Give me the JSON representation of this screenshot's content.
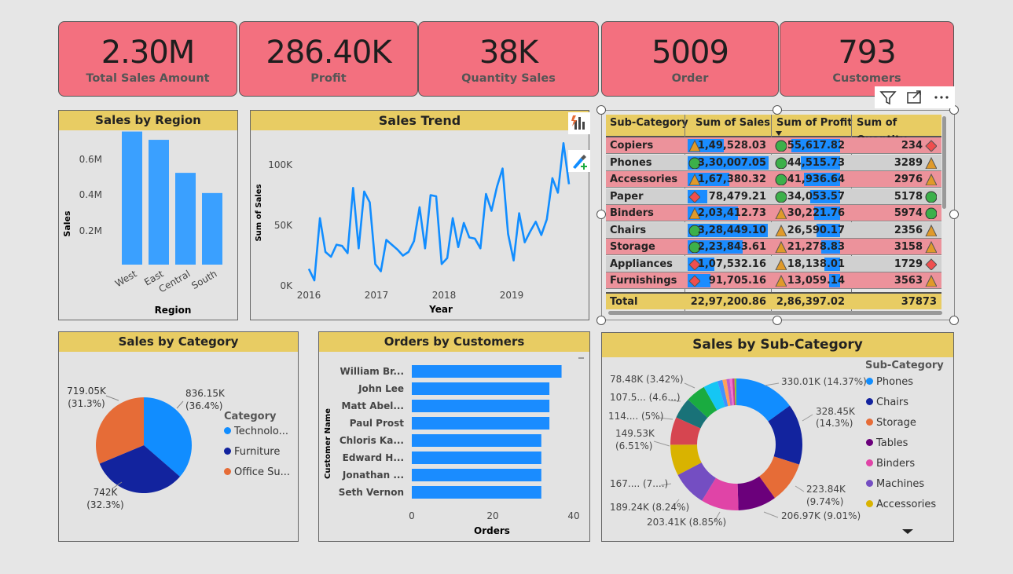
{
  "kpis": [
    {
      "value": "2.30M",
      "label": "Total Sales Amount"
    },
    {
      "value": "286.40K",
      "label": "Profit"
    },
    {
      "value": "38K",
      "label": "Quantity Sales"
    },
    {
      "value": "5009",
      "label": "Order"
    },
    {
      "value": "793",
      "label": "Customers"
    }
  ],
  "region_chart": {
    "title": "Sales by Region",
    "ylabel": "Sales",
    "xlabel": "Region",
    "ticks": [
      "0.2M",
      "0.4M",
      "0.6M"
    ],
    "chart_data": {
      "type": "bar",
      "categories": [
        "West",
        "East",
        "Central",
        "South"
      ],
      "values": [
        725000,
        680000,
        500000,
        390000
      ],
      "xlabel": "Region",
      "ylabel": "Sales",
      "ylim": [
        0,
        800000
      ]
    }
  },
  "trend_chart": {
    "title": "Sales Trend",
    "ylabel": "Sum of Sales",
    "xlabel": "Year",
    "yticks": [
      "0K",
      "50K",
      "100K"
    ],
    "xticks": [
      "2016",
      "2017",
      "2018",
      "2019"
    ],
    "chart_data": {
      "type": "line",
      "x": [
        "2016-01",
        "2016-02",
        "2016-03",
        "2016-04",
        "2016-05",
        "2016-06",
        "2016-07",
        "2016-08",
        "2016-09",
        "2016-10",
        "2016-11",
        "2016-12",
        "2017-01",
        "2017-02",
        "2017-03",
        "2017-04",
        "2017-05",
        "2017-06",
        "2017-07",
        "2017-08",
        "2017-09",
        "2017-10",
        "2017-11",
        "2017-12",
        "2018-01",
        "2018-02",
        "2018-03",
        "2018-04",
        "2018-05",
        "2018-06",
        "2018-07",
        "2018-08",
        "2018-09",
        "2018-10",
        "2018-11",
        "2018-12",
        "2019-01",
        "2019-02",
        "2019-03",
        "2019-04",
        "2019-05",
        "2019-06",
        "2019-07",
        "2019-08",
        "2019-09",
        "2019-10",
        "2019-11",
        "2019-12"
      ],
      "values": [
        14000,
        4500,
        56000,
        28000,
        24000,
        34000,
        33000,
        27000,
        81000,
        31000,
        78000,
        69000,
        18000,
        12000,
        38000,
        34000,
        30000,
        25000,
        28000,
        37000,
        65000,
        31000,
        75000,
        74000,
        18000,
        23000,
        56000,
        32000,
        52000,
        40000,
        39000,
        31000,
        76000,
        62000,
        82000,
        97000,
        43000,
        21000,
        60000,
        36000,
        45000,
        53000,
        42000,
        55000,
        89000,
        77000,
        118000,
        84000
      ],
      "xlabel": "Year",
      "ylabel": "Sum of Sales",
      "ylim": [
        0,
        120000
      ]
    }
  },
  "table": {
    "headers": [
      "Sub-Category",
      "Sum of Sales",
      "Sum of Profit",
      "Sum of Quantity"
    ],
    "rows": [
      {
        "name": "Copiers",
        "sales": "1,49,528.03",
        "profit": "55,617.82",
        "qty": "234",
        "sales_frac": 0.45,
        "profit_frac": 1.0,
        "si": "triangle",
        "pi": "circle",
        "qi": "diamond"
      },
      {
        "name": "Phones",
        "sales": "3,30,007.05",
        "profit": "44,515.73",
        "qty": "3289",
        "sales_frac": 1.0,
        "profit_frac": 0.8,
        "si": "circle",
        "pi": "circle",
        "qi": "triangle"
      },
      {
        "name": "Accessories",
        "sales": "1,67,380.32",
        "profit": "41,936.64",
        "qty": "2976",
        "sales_frac": 0.51,
        "profit_frac": 0.75,
        "si": "triangle",
        "pi": "circle",
        "qi": "triangle"
      },
      {
        "name": "Paper",
        "sales": "78,479.21",
        "profit": "34,053.57",
        "qty": "5178",
        "sales_frac": 0.24,
        "profit_frac": 0.61,
        "si": "diamond",
        "pi": "circle",
        "qi": "circle"
      },
      {
        "name": "Binders",
        "sales": "2,03,412.73",
        "profit": "30,221.76",
        "qty": "5974",
        "sales_frac": 0.62,
        "profit_frac": 0.54,
        "si": "triangle",
        "pi": "triangle",
        "qi": "circle"
      },
      {
        "name": "Chairs",
        "sales": "3,28,449.10",
        "profit": "26,590.17",
        "qty": "2356",
        "sales_frac": 0.99,
        "profit_frac": 0.48,
        "si": "circle",
        "pi": "triangle",
        "qi": "triangle"
      },
      {
        "name": "Storage",
        "sales": "2,23,843.61",
        "profit": "21,278.83",
        "qty": "3158",
        "sales_frac": 0.68,
        "profit_frac": 0.38,
        "si": "circle",
        "pi": "triangle",
        "qi": "triangle"
      },
      {
        "name": "Appliances",
        "sales": "1,07,532.16",
        "profit": "18,138.01",
        "qty": "1729",
        "sales_frac": 0.33,
        "profit_frac": 0.33,
        "si": "diamond",
        "pi": "triangle",
        "qi": "diamond"
      },
      {
        "name": "Furnishings",
        "sales": "91,705.16",
        "profit": "13,059.14",
        "qty": "3563",
        "sales_frac": 0.28,
        "profit_frac": 0.23,
        "si": "diamond",
        "pi": "triangle",
        "qi": "triangle"
      }
    ],
    "total": {
      "name": "Total",
      "sales": "22,97,200.86",
      "profit": "2,86,397.02",
      "qty": "37873"
    }
  },
  "category_chart": {
    "title": "Sales by Category",
    "legend_title": "Category",
    "labels": [
      {
        "top": "836.15K",
        "bottom": "(36.4%)"
      },
      {
        "top": "742K",
        "bottom": "(32.3%)"
      },
      {
        "top": "719.05K",
        "bottom": "(31.3%)"
      }
    ],
    "legend": [
      "Technolo...",
      "Furniture",
      "Office Su..."
    ],
    "colors": [
      "#118dff",
      "#12239e",
      "#e66c37"
    ],
    "chart_data": {
      "type": "pie",
      "categories": [
        "Technology",
        "Furniture",
        "Office Supplies"
      ],
      "values": [
        836150,
        742000,
        719050
      ]
    }
  },
  "customers_chart": {
    "title": "Orders by Customers",
    "ylabel": "Customer Name",
    "xlabel": "Orders",
    "xticks": [
      "0",
      "20",
      "40"
    ],
    "chart_data": {
      "type": "bar",
      "categories": [
        "William Br...",
        "John Lee",
        "Matt Abel...",
        "Paul Prost",
        "Chloris Ka...",
        "Edward H...",
        "Jonathan ...",
        "Seth Vernon"
      ],
      "values": [
        37,
        34,
        34,
        34,
        32,
        32,
        32,
        32
      ],
      "xlabel": "Orders",
      "ylabel": "Customer Name",
      "xlim": [
        0,
        42
      ]
    }
  },
  "subcat_chart": {
    "title": "Sales by Sub-Category",
    "legend_title": "Sub-Category",
    "legend": [
      "Phones",
      "Chairs",
      "Storage",
      "Tables",
      "Binders",
      "Machines",
      "Accessories"
    ],
    "colors": [
      "#118dff",
      "#12239e",
      "#e66c37",
      "#6b007b",
      "#e044a7",
      "#744ec2",
      "#d9b300",
      "#d64550",
      "#197278",
      "#1aab40",
      "#15c6f4",
      "#4092ff",
      "#ffa058",
      "#be5dc9",
      "#f472d0",
      "#c83d95",
      "#93bf35"
    ],
    "labels": [
      {
        "a": "330.01K (14.37%)"
      },
      {
        "a": "328.45K",
        "b": "(14.3%)"
      },
      {
        "a": "223.84K",
        "b": "(9.74%)"
      },
      {
        "a": "206.97K (9.01%)"
      },
      {
        "a": "203.41K (8.85%)"
      },
      {
        "a": "189.24K (8.24%)"
      },
      {
        "a": "167.... (7....)"
      },
      {
        "a": "149.53K",
        "b": "(6.51%)"
      },
      {
        "a": "114.... (5%)"
      },
      {
        "a": "107.5... (4.6...)"
      },
      {
        "a": "78.48K (3.42%)"
      }
    ],
    "chart_data": {
      "type": "pie",
      "values": [
        330010,
        328450,
        223840,
        206970,
        203410,
        189240,
        167000,
        149530,
        114000,
        107500,
        78480,
        27000,
        22000,
        17000,
        14000,
        12000,
        10000
      ]
    }
  }
}
